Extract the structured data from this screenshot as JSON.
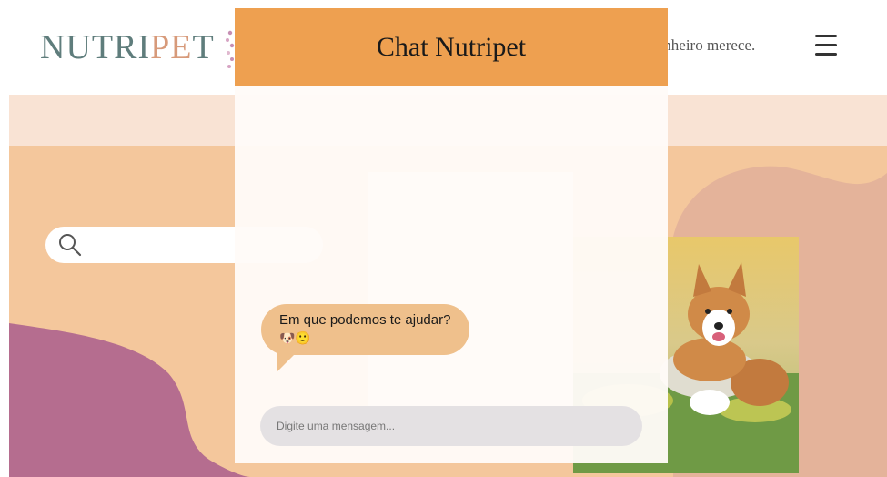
{
  "header": {
    "logo_part1": "NUTRI",
    "logo_part2": "PE",
    "logo_part3": "T",
    "tagline": "mpanheiro merece.",
    "menu_icon": "hamburger-icon"
  },
  "search": {
    "icon": "search-icon",
    "placeholder": ""
  },
  "chat": {
    "title": "Chat Nutripet",
    "messages": [
      {
        "text": "Em que podemos te ajudar?",
        "emoji": "🐶🙂"
      }
    ],
    "input_placeholder": "Digite uma mensagem..."
  },
  "colors": {
    "chat_header": "#eea050",
    "bubble": "#efc08c",
    "hero_bg": "#f4c79c",
    "band": "#f9e3d4",
    "purple_blob": "#b56d8f",
    "pink_blob": "#e4b39a",
    "logo": "#5f7d7c"
  }
}
